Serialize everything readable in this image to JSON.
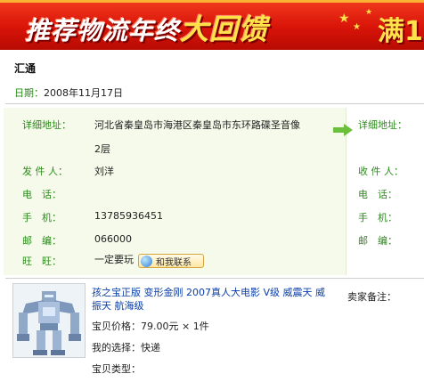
{
  "banner": {
    "title_main": "推荐物流年终",
    "title_highlight": "大回馈",
    "right_text": "满1"
  },
  "courier": {
    "name": "汇通",
    "date_label": "日期：",
    "date_value": "2008年11月17日"
  },
  "sender": {
    "address_label": "详细地址：",
    "address_line1": "河北省秦皇岛市海港区秦皇岛市东环路碟圣音像",
    "address_line2": "2层",
    "name_label": "发 件 人：",
    "name_value": "刘洋",
    "phone_label": "电　话：",
    "phone_value": "",
    "mobile_label": "手　机：",
    "mobile_value": "13785936451",
    "postcode_label": "邮　编：",
    "postcode_value": "066000",
    "wangwang_label": "旺　旺：",
    "wangwang_value": "一定要玩",
    "contact_button": "和我联系"
  },
  "receiver": {
    "address_label": "详细地址：",
    "name_label": "收 件 人：",
    "phone_label": "电　话：",
    "mobile_label": "手　机：",
    "postcode_label": "邮　编："
  },
  "product": {
    "title": "孩之宝正版 变形金刚 2007真人大电影 V级 威震天 威振天 航海级",
    "price_label": "宝贝价格：",
    "price_value": "79.00元 × 1件",
    "choice_label": "我的选择：",
    "choice_value": "快递",
    "type_label": "宝贝类型：",
    "type_value": "",
    "buyer_note_label": "卖家备注："
  },
  "colors": {
    "banner_red": "#d91409",
    "label_green": "#2c8a1c",
    "link_blue": "#0a3ea8",
    "panel_bg": "#f5faea"
  }
}
